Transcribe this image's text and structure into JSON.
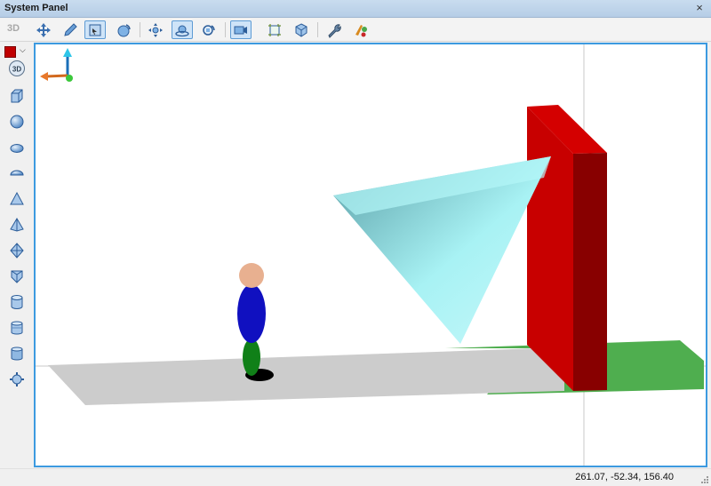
{
  "window": {
    "title": "System Panel",
    "close_glyph": "×"
  },
  "toolbar": {
    "mode_label": "3D",
    "buttons": [
      {
        "icon": "move-arrows-icon"
      },
      {
        "icon": "pencil-icon"
      },
      {
        "icon": "select-square-icon",
        "active": true
      },
      {
        "icon": "rotate-sphere-icon"
      },
      {
        "icon": "pan-icon"
      },
      {
        "icon": "orbit-icon",
        "active": true
      },
      {
        "icon": "zoom-rotate-icon"
      },
      {
        "icon": "camera-view-icon",
        "active": true
      },
      {
        "icon": "frame-icon"
      },
      {
        "icon": "cube-shade-icon"
      },
      {
        "icon": "wrench-icon"
      },
      {
        "icon": "paint-tools-icon"
      }
    ]
  },
  "sidebar": {
    "color_swatch": "#c00000",
    "view_label": "3D",
    "shapes": [
      "box",
      "sphere",
      "ellipsoid",
      "capsule",
      "cone",
      "pyramid",
      "octahedron",
      "prism",
      "cylinder",
      "tall-cylinder",
      "barrel",
      "gear-ring"
    ]
  },
  "scene": {
    "floor_color": "#cccccc",
    "wall_color": "#c80000",
    "cone_color": "#a8f2f4",
    "grass_color": "#4fae4f",
    "figure": {
      "head": "#e8b090",
      "body": "#1010c0",
      "legs": "#108018"
    }
  },
  "status": {
    "coordinates": "261.07, -52.34, 156.40"
  }
}
